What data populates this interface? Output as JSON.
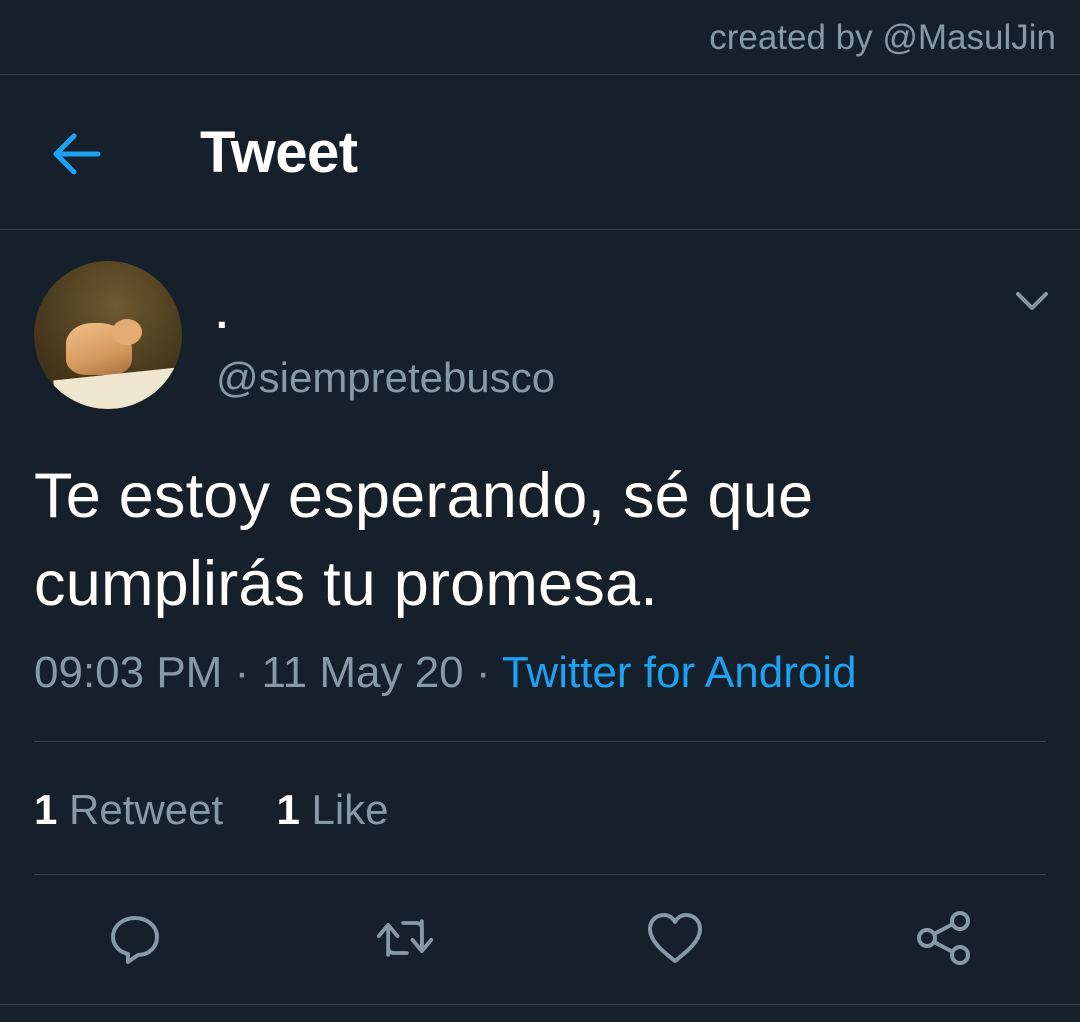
{
  "credit": "created by @MasulJin",
  "header": {
    "title": "Tweet",
    "back_icon": "arrow-left-icon"
  },
  "tweet": {
    "display_name": ".",
    "handle": "@siempretebusco",
    "text_line1": "Te estoy esperando, sé que",
    "text_line2": "cumplirás tu promesa.",
    "time": "09:03 PM",
    "date": "11 May 20",
    "separator": " · ",
    "client": "Twitter for Android",
    "retweet_count": "1",
    "retweet_label": "Retweet",
    "like_count": "1",
    "like_label": "Like"
  },
  "actions": [
    "reply-icon",
    "retweet-icon",
    "heart-icon",
    "share-icon"
  ],
  "colors": {
    "background": "#15202b",
    "accent": "#1da1f2",
    "secondary_text": "#8899a6",
    "divider": "#38444d"
  }
}
